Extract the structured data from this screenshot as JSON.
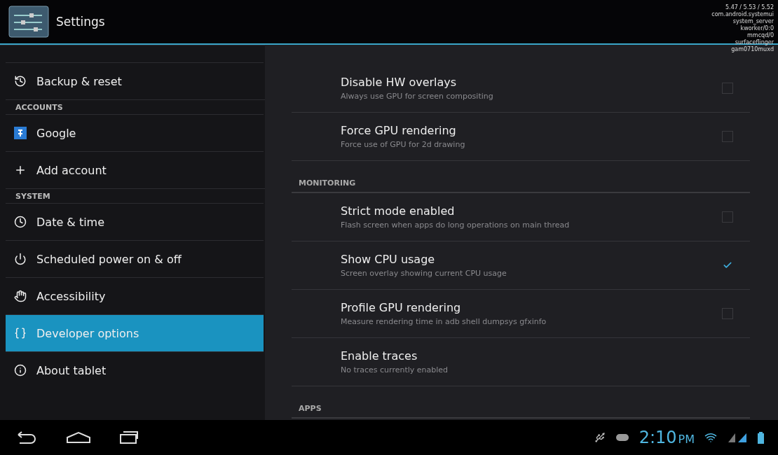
{
  "action_bar": {
    "title": "Settings"
  },
  "cpu_overlay": {
    "load": "5.47 / 5.53 / 5.52",
    "processes": [
      "com.android.systemui",
      "system_server",
      "kworker/0:0",
      "mmcqd/0",
      "surfaceflinger",
      "gam0710muxd"
    ]
  },
  "sidebar": {
    "items": [
      {
        "kind": "item",
        "label": "Backup & reset",
        "selected": false
      },
      {
        "kind": "header",
        "label": "ACCOUNTS"
      },
      {
        "kind": "item",
        "label": "Google",
        "selected": false
      },
      {
        "kind": "item",
        "label": "Add account",
        "selected": false
      },
      {
        "kind": "header",
        "label": "SYSTEM"
      },
      {
        "kind": "item",
        "label": "Date & time",
        "selected": false
      },
      {
        "kind": "item",
        "label": "Scheduled power on & off",
        "selected": false
      },
      {
        "kind": "item",
        "label": "Accessibility",
        "selected": false
      },
      {
        "kind": "item",
        "label": "Developer options",
        "selected": true
      },
      {
        "kind": "item",
        "label": "About tablet",
        "selected": false
      }
    ]
  },
  "settings": [
    {
      "kind": "checkbox",
      "title": "Disable HW overlays",
      "summary": "Always use GPU for screen compositing",
      "checked": false
    },
    {
      "kind": "checkbox",
      "title": "Force GPU rendering",
      "summary": "Force use of GPU for 2d drawing",
      "checked": false
    },
    {
      "kind": "header",
      "title": "MONITORING"
    },
    {
      "kind": "checkbox",
      "title": "Strict mode enabled",
      "summary": "Flash screen when apps do long operations on main thread",
      "checked": false
    },
    {
      "kind": "checkbox",
      "title": "Show CPU usage",
      "summary": "Screen overlay showing current CPU usage",
      "checked": true
    },
    {
      "kind": "checkbox",
      "title": "Profile GPU rendering",
      "summary": "Measure rendering time in adb shell dumpsys gfxinfo",
      "checked": false
    },
    {
      "kind": "plain",
      "title": "Enable traces",
      "summary": "No traces currently enabled"
    },
    {
      "kind": "header",
      "title": "APPS"
    }
  ],
  "status_bar": {
    "time": "2:10",
    "ampm": "PM"
  }
}
